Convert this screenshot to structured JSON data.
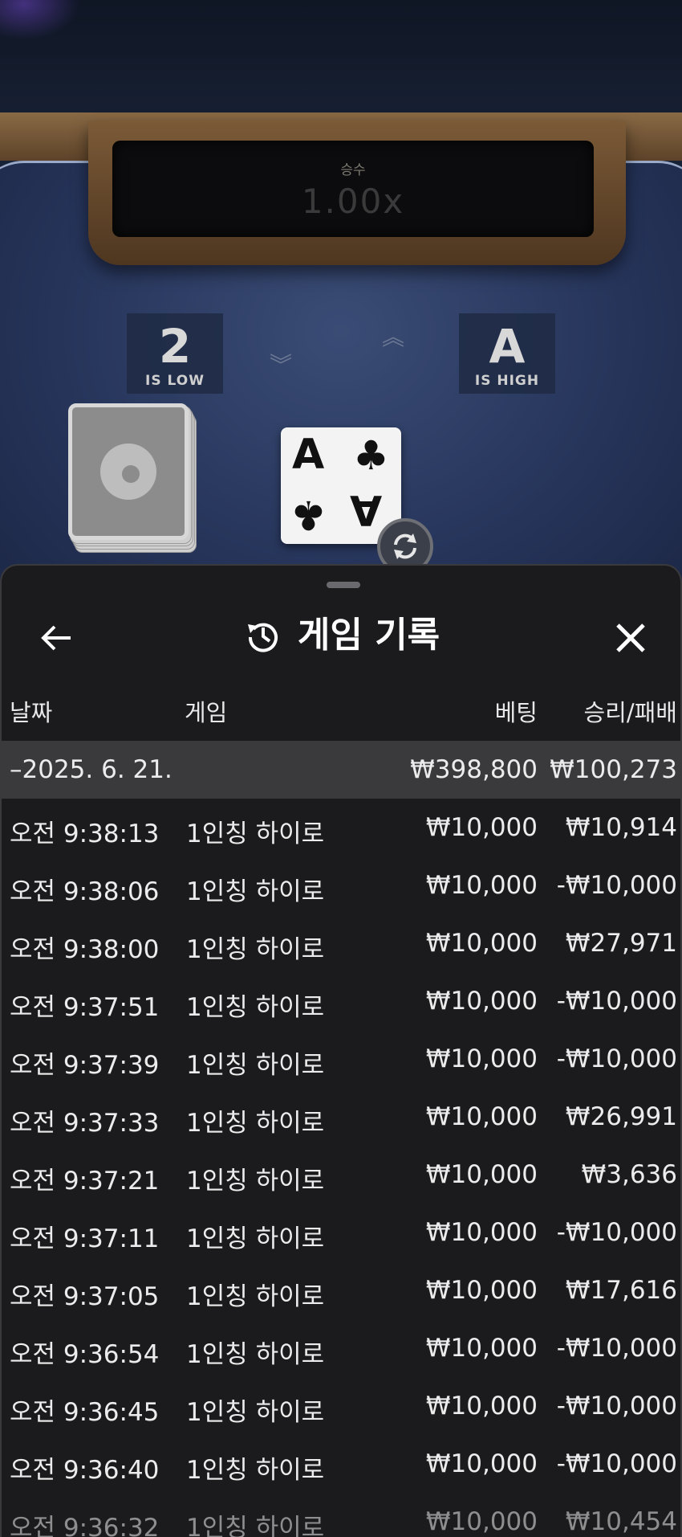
{
  "game": {
    "multiplier_label": "승수",
    "multiplier_value": "1.00x",
    "low_card": {
      "rank": "2",
      "label": "IS LOW"
    },
    "high_card": {
      "rank": "A",
      "label": "IS HIGH"
    },
    "current_card": {
      "rank": "A",
      "suit": "♣"
    }
  },
  "history": {
    "title": "게임 기록",
    "columns": {
      "date": "날짜",
      "game": "게임",
      "bet": "베팅",
      "win_loss": "승리/패배"
    },
    "date_group": {
      "date": "–2025. 6. 21.",
      "bet_total": "₩398,800",
      "win_total": "₩100,273"
    },
    "rows": [
      {
        "time": "오전 9:38:13",
        "game": "1인칭 하이로",
        "bet": "₩10,000",
        "result": "₩10,914"
      },
      {
        "time": "오전 9:38:06",
        "game": "1인칭 하이로",
        "bet": "₩10,000",
        "result": "-₩10,000"
      },
      {
        "time": "오전 9:38:00",
        "game": "1인칭 하이로",
        "bet": "₩10,000",
        "result": "₩27,971"
      },
      {
        "time": "오전 9:37:51",
        "game": "1인칭 하이로",
        "bet": "₩10,000",
        "result": "-₩10,000"
      },
      {
        "time": "오전 9:37:39",
        "game": "1인칭 하이로",
        "bet": "₩10,000",
        "result": "-₩10,000"
      },
      {
        "time": "오전 9:37:33",
        "game": "1인칭 하이로",
        "bet": "₩10,000",
        "result": "₩26,991"
      },
      {
        "time": "오전 9:37:21",
        "game": "1인칭 하이로",
        "bet": "₩10,000",
        "result": "₩3,636"
      },
      {
        "time": "오전 9:37:11",
        "game": "1인칭 하이로",
        "bet": "₩10,000",
        "result": "-₩10,000"
      },
      {
        "time": "오전 9:37:05",
        "game": "1인칭 하이로",
        "bet": "₩10,000",
        "result": "₩17,616"
      },
      {
        "time": "오전 9:36:54",
        "game": "1인칭 하이로",
        "bet": "₩10,000",
        "result": "-₩10,000"
      },
      {
        "time": "오전 9:36:45",
        "game": "1인칭 하이로",
        "bet": "₩10,000",
        "result": "-₩10,000"
      },
      {
        "time": "오전 9:36:40",
        "game": "1인칭 하이로",
        "bet": "₩10,000",
        "result": "-₩10,000"
      },
      {
        "time": "오전 9:36:32",
        "game": "1인칭 하이로",
        "bet": "₩10,000",
        "result": "₩10,454"
      }
    ]
  },
  "icons": {
    "back": "arrow-left-icon",
    "history": "history-icon",
    "close": "close-icon",
    "swap": "swap-icon",
    "suit": "clubs-icon"
  }
}
